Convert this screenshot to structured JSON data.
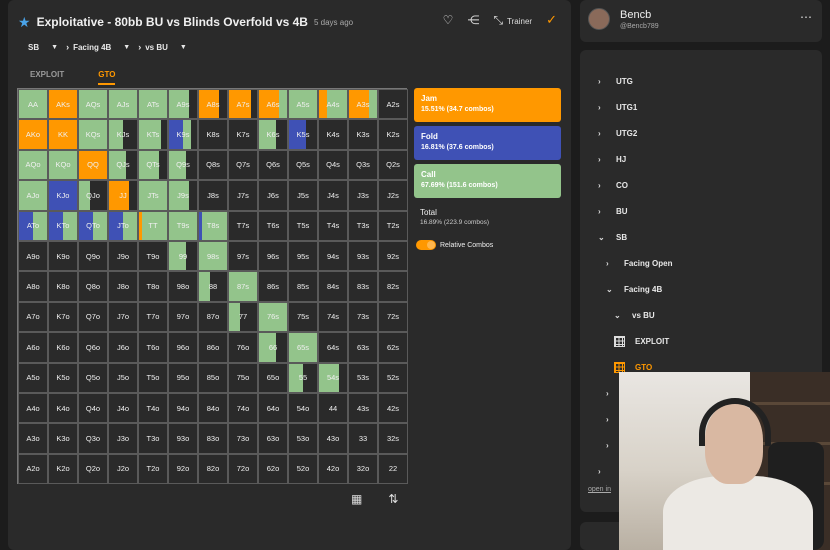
{
  "header": {
    "title": "Exploitative - 80bb BU vs Blinds Overfold vs 4B",
    "ago": "5 days ago",
    "trainer_label": "Trainer"
  },
  "breadcrumbs": [
    {
      "label": "SB"
    },
    {
      "label": "Facing 4B"
    },
    {
      "label": "vs BU"
    }
  ],
  "tabs": [
    {
      "label": "EXPLOIT"
    },
    {
      "label": "GTO"
    }
  ],
  "colors": {
    "jam": "#ff9800",
    "fold": "#3f51b5",
    "call": "#93c48b",
    "empty": "#2a2a2a"
  },
  "matrix": [
    [
      "AA",
      "AKs",
      "AQs",
      "AJs",
      "ATs",
      "A9s",
      "A8s",
      "A7s",
      "A6s",
      "A5s",
      "A4s",
      "A3s",
      "A2s"
    ],
    [
      "AKo",
      "KK",
      "KQs",
      "KJs",
      "KTs",
      "K9s",
      "K8s",
      "K7s",
      "K6s",
      "K5s",
      "K4s",
      "K3s",
      "K2s"
    ],
    [
      "AQo",
      "KQo",
      "QQ",
      "QJs",
      "QTs",
      "Q9s",
      "Q8s",
      "Q7s",
      "Q6s",
      "Q5s",
      "Q4s",
      "Q3s",
      "Q2s"
    ],
    [
      "AJo",
      "KJo",
      "QJo",
      "JJ",
      "JTs",
      "J9s",
      "J8s",
      "J7s",
      "J6s",
      "J5s",
      "J4s",
      "J3s",
      "J2s"
    ],
    [
      "ATo",
      "KTo",
      "QTo",
      "JTo",
      "TT",
      "T9s",
      "T8s",
      "T7s",
      "T6s",
      "T5s",
      "T4s",
      "T3s",
      "T2s"
    ],
    [
      "A9o",
      "K9o",
      "Q9o",
      "J9o",
      "T9o",
      "99",
      "98s",
      "97s",
      "96s",
      "95s",
      "94s",
      "93s",
      "92s"
    ],
    [
      "A8o",
      "K8o",
      "Q8o",
      "J8o",
      "T8o",
      "98o",
      "88",
      "87s",
      "86s",
      "85s",
      "84s",
      "83s",
      "82s"
    ],
    [
      "A7o",
      "K7o",
      "Q7o",
      "J7o",
      "T7o",
      "97o",
      "87o",
      "77",
      "76s",
      "75s",
      "74s",
      "73s",
      "72s"
    ],
    [
      "A6o",
      "K6o",
      "Q6o",
      "J6o",
      "T6o",
      "96o",
      "86o",
      "76o",
      "66",
      "65s",
      "64s",
      "63s",
      "62s"
    ],
    [
      "A5o",
      "K5o",
      "Q5o",
      "J5o",
      "T5o",
      "95o",
      "85o",
      "75o",
      "65o",
      "55",
      "54s",
      "53s",
      "52s"
    ],
    [
      "A4o",
      "K4o",
      "Q4o",
      "J4o",
      "T4o",
      "94o",
      "84o",
      "74o",
      "64o",
      "54o",
      "44",
      "43s",
      "42s"
    ],
    [
      "A3o",
      "K3o",
      "Q3o",
      "J3o",
      "T3o",
      "93o",
      "83o",
      "73o",
      "63o",
      "53o",
      "43o",
      "33",
      "32s"
    ],
    [
      "A2o",
      "K2o",
      "Q2o",
      "J2o",
      "T2o",
      "92o",
      "82o",
      "72o",
      "62o",
      "52o",
      "42o",
      "32o",
      "22"
    ]
  ],
  "frequencies": {
    "AA": [
      0,
      0,
      1
    ],
    "AKs": [
      1,
      0,
      0
    ],
    "AQs": [
      0,
      0,
      1
    ],
    "AJs": [
      0,
      0,
      1
    ],
    "ATs": [
      0,
      0,
      1
    ],
    "A9s": [
      0,
      0,
      0.7
    ],
    "A8s": [
      0.7,
      0,
      0
    ],
    "A7s": [
      0.8,
      0,
      0
    ],
    "A6s": [
      0.7,
      0,
      0.3
    ],
    "A5s": [
      0,
      0,
      1
    ],
    "A4s": [
      0.3,
      0,
      0.7
    ],
    "A3s": [
      0.7,
      0,
      0.3
    ],
    "AKo": [
      1,
      0,
      0
    ],
    "KK": [
      1,
      0,
      0
    ],
    "KQs": [
      0,
      0,
      1
    ],
    "KJs": [
      0,
      0,
      0.5
    ],
    "KTs": [
      0,
      0,
      0.8
    ],
    "K9s": [
      0,
      0.5,
      0.3
    ],
    "K6s": [
      0,
      0,
      0.6
    ],
    "K5s": [
      0,
      0.6,
      0
    ],
    "AQo": [
      0,
      0,
      1
    ],
    "KQo": [
      0,
      0,
      1
    ],
    "QQ": [
      1,
      0,
      0
    ],
    "QJs": [
      0,
      0,
      0.6
    ],
    "QTs": [
      0,
      0,
      0.7
    ],
    "Q9s": [
      0,
      0,
      0.6
    ],
    "AJo": [
      0,
      0,
      1
    ],
    "KJo": [
      0,
      1,
      0
    ],
    "QJo": [
      0,
      0,
      0.4
    ],
    "JJ": [
      0.7,
      0,
      0
    ],
    "JTs": [
      0,
      0,
      1
    ],
    "J9s": [
      0,
      0,
      0.7
    ],
    "ATo": [
      0,
      0.5,
      0.5
    ],
    "KTo": [
      0,
      0.5,
      0.5
    ],
    "QTo": [
      0,
      0.5,
      0.5
    ],
    "JTo": [
      0,
      0.5,
      0.5
    ],
    "TT": [
      0.1,
      0,
      0.9
    ],
    "T9s": [
      0,
      0,
      1
    ],
    "T8s": [
      0,
      0.1,
      0.9
    ],
    "99": [
      0,
      0,
      0.6
    ],
    "98s": [
      0,
      0,
      1
    ],
    "88": [
      0,
      0,
      0.4
    ],
    "87s": [
      0,
      0,
      1
    ],
    "77": [
      0,
      0,
      0.4
    ],
    "76s": [
      0,
      0,
      1
    ],
    "66": [
      0,
      0,
      0.6
    ],
    "65s": [
      0,
      0,
      1
    ],
    "55": [
      0,
      0,
      0.5
    ],
    "54s": [
      0,
      0,
      0.7
    ]
  },
  "legend": [
    {
      "name": "Jam",
      "value": "15.51% (34.7 combos)"
    },
    {
      "name": "Fold",
      "value": "16.81% (37.6 combos)"
    },
    {
      "name": "Call",
      "value": "67.69% (151.6 combos)"
    }
  ],
  "total": {
    "name": "Total",
    "value": "16.89% (223.9 combos)"
  },
  "toggle_label": "Relative Combos",
  "user": {
    "name": "Bencb",
    "handle": "@Bencb789"
  },
  "tree": [
    {
      "label": "UTG",
      "indent": 0,
      "chev": "›"
    },
    {
      "label": "UTG1",
      "indent": 0,
      "chev": "›"
    },
    {
      "label": "UTG2",
      "indent": 0,
      "chev": "›"
    },
    {
      "label": "HJ",
      "indent": 0,
      "chev": "›"
    },
    {
      "label": "CO",
      "indent": 0,
      "chev": "›"
    },
    {
      "label": "BU",
      "indent": 0,
      "chev": "›"
    },
    {
      "label": "SB",
      "indent": 0,
      "chev": "⌄"
    },
    {
      "label": "Facing Open",
      "indent": 1,
      "chev": "›"
    },
    {
      "label": "Facing 4B",
      "indent": 1,
      "chev": "⌄"
    },
    {
      "label": "vs BU",
      "indent": 2,
      "chev": "⌄"
    },
    {
      "label": "EXPLOIT",
      "indent": 2,
      "icon": "grid"
    },
    {
      "label": "GTO",
      "indent": 2,
      "icon": "grid-orange"
    },
    {
      "label": "",
      "indent": 1,
      "chev": "›"
    },
    {
      "label": "",
      "indent": 1,
      "chev": "›"
    },
    {
      "label": "",
      "indent": 1,
      "chev": "›"
    },
    {
      "label": "",
      "indent": 0,
      "chev": "›"
    }
  ],
  "open_link": "open in"
}
